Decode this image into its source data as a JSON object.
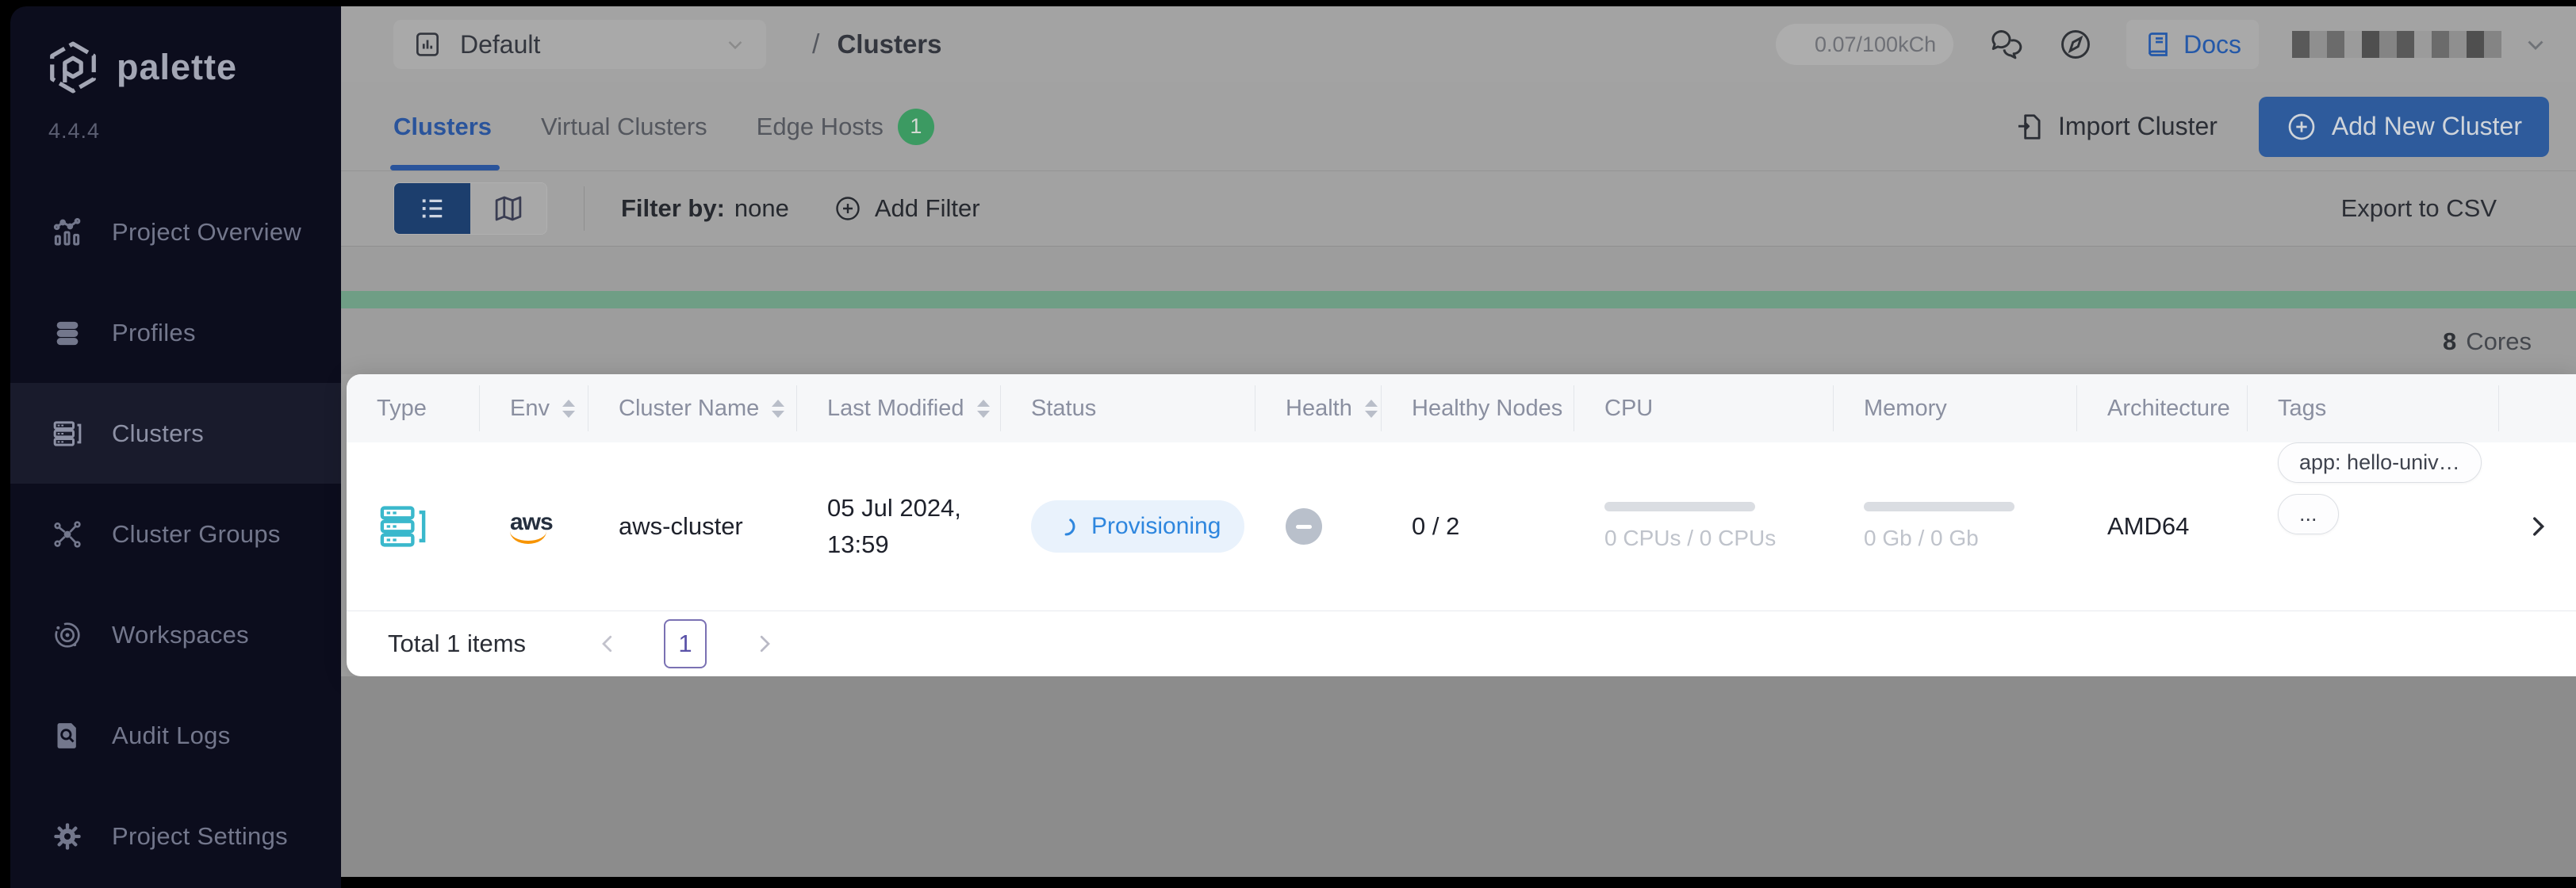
{
  "brand": {
    "name": "palette",
    "version": "4.4.4"
  },
  "sidebar": {
    "items": [
      {
        "label": "Project Overview",
        "icon": "bar-chart-icon"
      },
      {
        "label": "Profiles",
        "icon": "layers-icon"
      },
      {
        "label": "Clusters",
        "icon": "server-stack-icon"
      },
      {
        "label": "Cluster Groups",
        "icon": "molecule-icon"
      },
      {
        "label": "Workspaces",
        "icon": "orbit-icon"
      },
      {
        "label": "Audit Logs",
        "icon": "document-search-icon"
      },
      {
        "label": "Project Settings",
        "icon": "gear-icon"
      }
    ],
    "active_item": "Clusters"
  },
  "topbar": {
    "project_selector": {
      "value": "Default"
    },
    "breadcrumb": {
      "separator": "/",
      "page": "Clusters"
    },
    "usage_badge": "0.07/100kCh",
    "docs_label": "Docs"
  },
  "tabs": {
    "clusters": "Clusters",
    "virtual_clusters": "Virtual Clusters",
    "edge_hosts": "Edge Hosts",
    "edge_hosts_count": "1"
  },
  "actions": {
    "import_cluster": "Import Cluster",
    "add_new_cluster": "Add New Cluster"
  },
  "filter_bar": {
    "filter_label": "Filter by:",
    "filter_value": "none",
    "add_filter": "Add Filter",
    "export_csv": "Export to CSV"
  },
  "usage_bar": {
    "value": "8",
    "unit": "Cores"
  },
  "table": {
    "columns": [
      {
        "label": "Type",
        "sortable": false
      },
      {
        "label": "Env",
        "sortable": true
      },
      {
        "label": "Cluster Name",
        "sortable": true
      },
      {
        "label": "Last Modified",
        "sortable": true
      },
      {
        "label": "Status",
        "sortable": false
      },
      {
        "label": "Health",
        "sortable": true
      },
      {
        "label": "Healthy Nodes",
        "sortable": false
      },
      {
        "label": "CPU",
        "sortable": false
      },
      {
        "label": "Memory",
        "sortable": false
      },
      {
        "label": "Architecture",
        "sortable": false
      },
      {
        "label": "Tags",
        "sortable": false
      }
    ],
    "rows": [
      {
        "type_icon": "cluster-type-icon",
        "env": "aws",
        "cluster_name": "aws-cluster",
        "last_modified_date": "05 Jul 2024,",
        "last_modified_time": "13:59",
        "status": "Provisioning",
        "healthy_nodes": "0 / 2",
        "cpu": "0 CPUs / 0 CPUs",
        "memory": "0 Gb / 0 Gb",
        "architecture": "AMD64",
        "tag_1": "app: hello-univ…",
        "tag_2": "..."
      }
    ]
  },
  "pagination": {
    "total": "Total 1 items",
    "current_page": "1"
  },
  "colors": {
    "sidebar_bg": "#0c0d1d",
    "accent_blue": "#2a549b",
    "add_button_bg": "#2e5b9c",
    "status_provisioning_text": "#2e86de",
    "status_provisioning_bg": "#e9f2fc",
    "edge_hosts_badge": "#3c9a62",
    "usage_bar_green": "#6f9e85",
    "aws_smile_orange": "#f79400",
    "cluster_type_teal": "#3ab8cc",
    "pagination_accent": "#5a52a8"
  }
}
